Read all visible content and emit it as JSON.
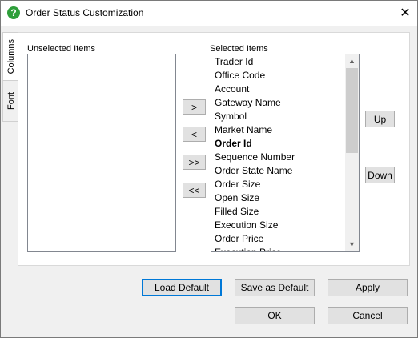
{
  "window": {
    "title": "Order Status Customization"
  },
  "tabs": [
    "Columns",
    "Font"
  ],
  "unselected": {
    "label": "Unselected Items",
    "items": []
  },
  "selected": {
    "label": "Selected Items",
    "items": [
      "Trader Id",
      "Office Code",
      "Account",
      "Gateway Name",
      "Symbol",
      "Market Name",
      "Order Id",
      "Sequence Number",
      "Order State Name",
      "Order Size",
      "Open Size",
      "Filled Size",
      "Execution Size",
      "Order Price",
      "Execution Price"
    ],
    "bold_item": "Order Id"
  },
  "transfer_buttons": {
    "move_right": ">",
    "move_left": "<",
    "move_all_right": ">>",
    "move_all_left": "<<"
  },
  "order_buttons": {
    "up": "Up",
    "down": "Down"
  },
  "footer": {
    "load_default": "Load Default",
    "save_as_default": "Save as Default",
    "apply": "Apply",
    "ok": "OK",
    "cancel": "Cancel"
  },
  "icons": {
    "app": "help-question-icon",
    "close": "close-icon"
  },
  "colors": {
    "app_icon": "#2e9f3a",
    "default_button_border": "#0078d7"
  }
}
